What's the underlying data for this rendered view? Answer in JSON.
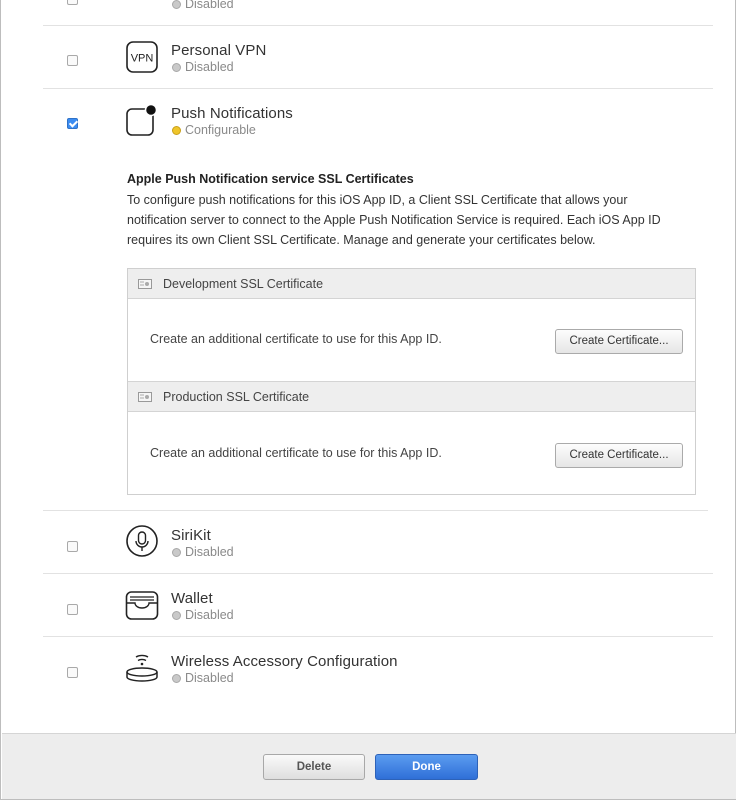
{
  "services": [
    {
      "name": "",
      "status": "Disabled",
      "checked": false,
      "icon": "partial-top-icon"
    },
    {
      "name": "Personal VPN",
      "status": "Disabled",
      "checked": false,
      "icon": "vpn-icon",
      "icon_text": "VPN"
    },
    {
      "name": "Push Notifications",
      "status": "Configurable",
      "checked": true,
      "icon": "push-notifications-icon"
    },
    {
      "name": "SiriKit",
      "status": "Disabled",
      "checked": false,
      "icon": "microphone-icon"
    },
    {
      "name": "Wallet",
      "status": "Disabled",
      "checked": false,
      "icon": "wallet-icon"
    },
    {
      "name": "Wireless Accessory Configuration",
      "status": "Disabled",
      "checked": false,
      "icon": "wireless-accessory-icon"
    }
  ],
  "push": {
    "title": "Apple Push Notification service SSL Certificates",
    "description": "To configure push notifications for this iOS App ID, a Client SSL Certificate that allows your notification server to connect to the Apple Push Notification Service is required. Each iOS App ID requires its own Client SSL Certificate. Manage and generate your certificates below.",
    "certificates": [
      {
        "title": "Development SSL Certificate",
        "text": "Create an additional certificate to use for this App ID.",
        "button": "Create Certificate..."
      },
      {
        "title": "Production SSL Certificate",
        "text": "Create an additional certificate to use for this App ID.",
        "button": "Create Certificate..."
      }
    ]
  },
  "footer": {
    "delete_label": "Delete",
    "done_label": "Done"
  },
  "colors": {
    "accent": "#3c8df2",
    "configurable": "#efc52a",
    "disabled": "#c9c9c9",
    "footer_bg": "#ededed"
  }
}
